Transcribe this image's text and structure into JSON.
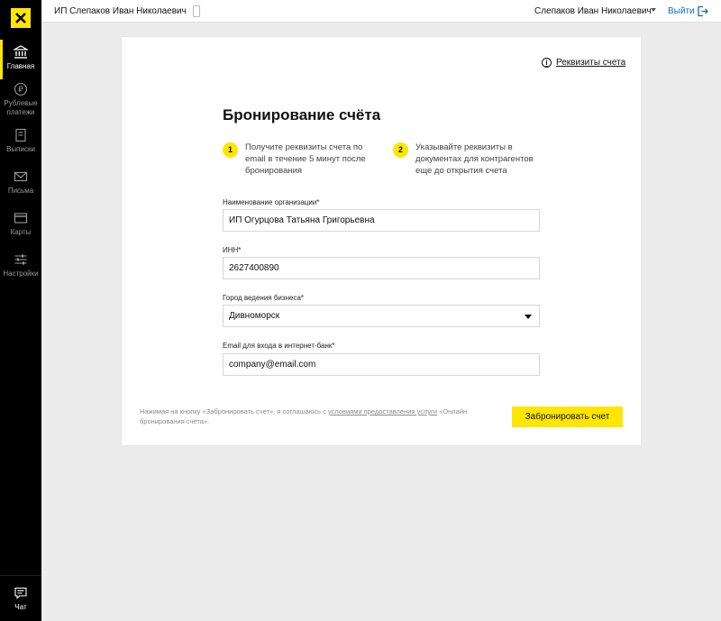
{
  "header": {
    "company": "ИП  Слепаков Иван Николаевич",
    "user": "Слепаков Иван Николаевич",
    "logout": "Выйти"
  },
  "sidebar": {
    "items": [
      {
        "label": "Главная",
        "icon": "bank-icon"
      },
      {
        "label": "Рублевые платежи",
        "icon": "ruble-icon"
      },
      {
        "label": "Выписки",
        "icon": "document-icon"
      },
      {
        "label": "Письма",
        "icon": "envelope-icon"
      },
      {
        "label": "Карты",
        "icon": "card-icon"
      },
      {
        "label": "Настройки",
        "icon": "sliders-icon"
      }
    ],
    "chat": {
      "label": "Чат",
      "icon": "chat-icon"
    }
  },
  "card": {
    "requisites_link": "Реквизиты счета",
    "title": "Бронирование счёта",
    "steps": [
      {
        "num": "1",
        "text": "Получите реквизиты счета по email в течение 5 минут после бронирования"
      },
      {
        "num": "2",
        "text": "Указывайте реквизиты в документах для контрагентов еще до открытия счета"
      }
    ],
    "fields": {
      "org": {
        "label": "Наименование организации*",
        "value": "ИП Огурцова Татьяна Григорьевна"
      },
      "inn": {
        "label": "ИНН*",
        "value": "2627400890"
      },
      "city": {
        "label": "Город ведения бизнеса*",
        "value": "Дивноморск"
      },
      "email": {
        "label": "Email для входа в интернет-банк*",
        "value": "company@email.com"
      }
    },
    "agreement": {
      "before": "Нажимая на кнопку «Забронировать счет», я соглашаюсь с ",
      "link": "условиями предоставления услуги",
      "after": " «Онлайн бронирования счета»."
    },
    "submit": "Забронировать счет"
  },
  "colors": {
    "accent": "#fee600",
    "link": "#1668c8",
    "sidebar": "#000000"
  }
}
